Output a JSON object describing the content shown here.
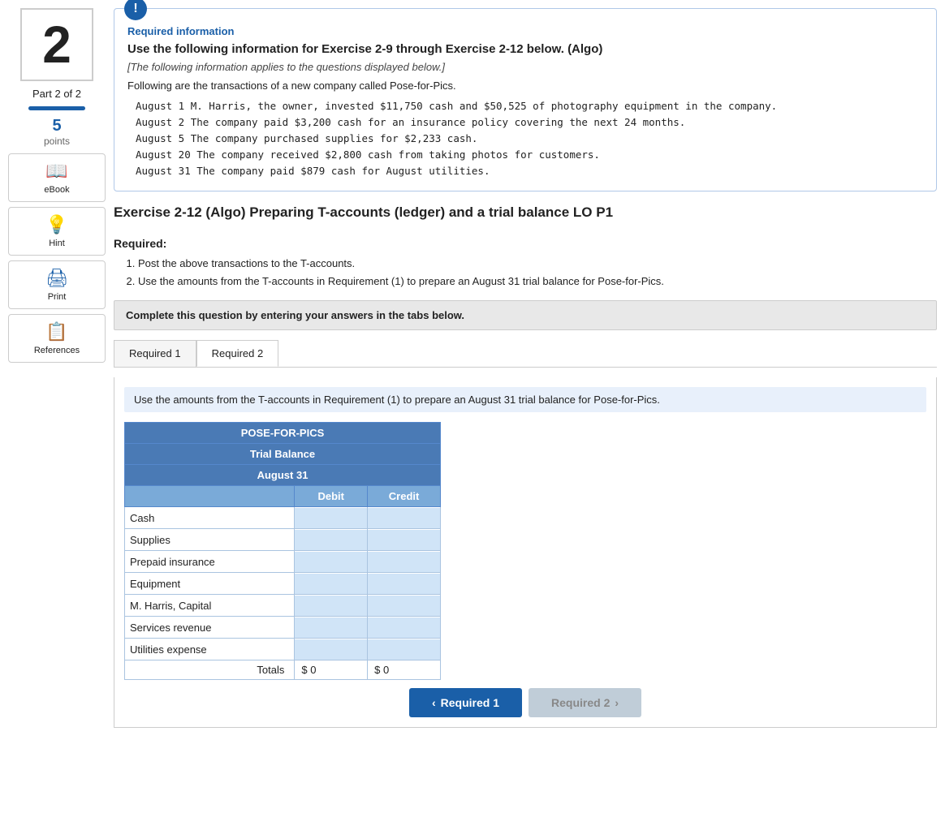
{
  "sidebar": {
    "step_number": "2",
    "part_label": "Part 2",
    "part_of": "of 2",
    "points_number": "5",
    "points_label": "points",
    "tools": [
      {
        "id": "ebook",
        "icon": "📖",
        "label": "eBook"
      },
      {
        "id": "hint",
        "icon": "💡",
        "label": "Hint"
      },
      {
        "id": "print",
        "icon": "🖨",
        "label": "Print"
      },
      {
        "id": "references",
        "icon": "📋",
        "label": "References"
      }
    ]
  },
  "info_box": {
    "required_label": "Required information",
    "title": "Use the following information for Exercise 2-9 through Exercise 2-12 below. (Algo)",
    "subtitle": "[The following information applies to the questions displayed below.]",
    "description": "Following are the transactions of a new company called Pose-for-Pics.",
    "transactions": [
      "August  1  M. Harris, the owner, invested $11,750 cash and $50,525 of photography equipment in the company.",
      "August  2  The company paid $3,200 cash for an insurance policy covering the next 24 months.",
      "August  5  The company purchased supplies for $2,233 cash.",
      "August 20  The company received $2,800 cash from taking photos for customers.",
      "August 31  The company paid $879 cash for August utilities."
    ]
  },
  "exercise": {
    "title": "Exercise 2-12 (Algo) Preparing T-accounts (ledger) and a trial balance LO P1"
  },
  "required_section": {
    "label": "Required:",
    "items": [
      "Post the above transactions to the T-accounts.",
      "Use the amounts from the T-accounts in Requirement (1) to prepare an August 31 trial balance for Pose-for-Pics."
    ]
  },
  "complete_banner": "Complete this question by entering your answers in the tabs below.",
  "tabs": [
    {
      "id": "req1",
      "label": "Required 1",
      "active": false
    },
    {
      "id": "req2",
      "label": "Required 2",
      "active": true
    }
  ],
  "tab_instruction": "Use the amounts from the T-accounts in Requirement (1) to prepare an August 31 trial balance for Pose-for-Pics.",
  "trial_balance": {
    "company": "POSE-FOR-PICS",
    "title": "Trial Balance",
    "date": "August 31",
    "col_debit": "Debit",
    "col_credit": "Credit",
    "rows": [
      {
        "account": "Cash",
        "debit": "",
        "credit": ""
      },
      {
        "account": "Supplies",
        "debit": "",
        "credit": ""
      },
      {
        "account": "Prepaid insurance",
        "debit": "",
        "credit": ""
      },
      {
        "account": "Equipment",
        "debit": "",
        "credit": ""
      },
      {
        "account": "M. Harris, Capital",
        "debit": "",
        "credit": ""
      },
      {
        "account": "Services revenue",
        "debit": "",
        "credit": ""
      },
      {
        "account": "Utilities expense",
        "debit": "",
        "credit": ""
      }
    ],
    "totals_label": "Totals",
    "total_debit_prefix": "$",
    "total_debit_value": "0",
    "total_credit_prefix": "$",
    "total_credit_value": "0"
  },
  "nav_buttons": {
    "prev_label": "Required 1",
    "next_label": "Required 2",
    "prev_arrow": "‹",
    "next_arrow": "›"
  }
}
